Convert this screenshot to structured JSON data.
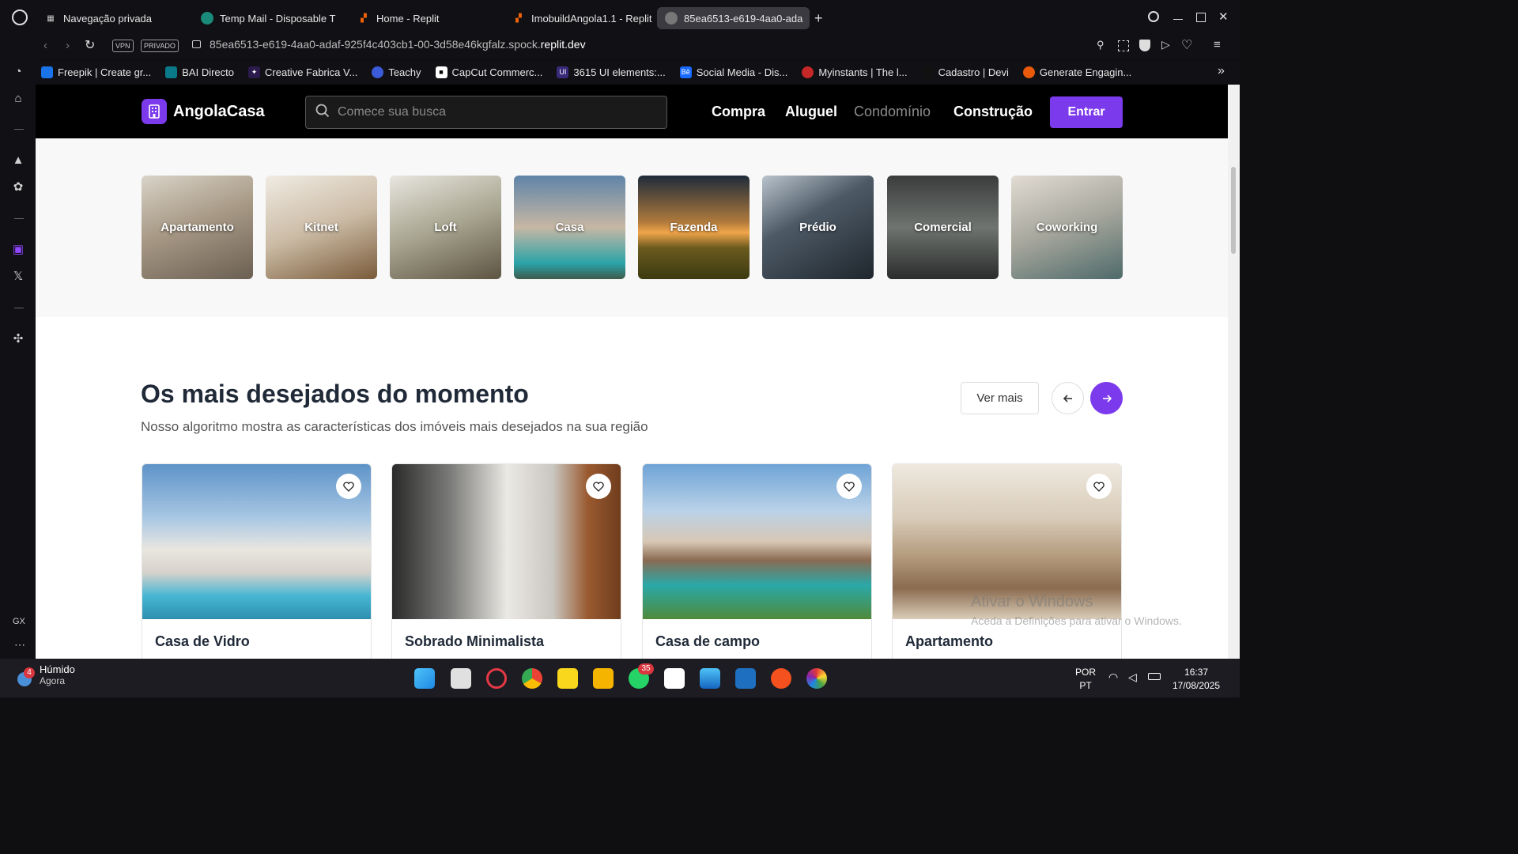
{
  "browser": {
    "tabs": [
      {
        "label": "Navegação privada"
      },
      {
        "label": "Temp Mail - Disposable T"
      },
      {
        "label": "Home - Replit"
      },
      {
        "label": "ImobuildAngola1.1 - Replit"
      },
      {
        "label": "85ea6513-e619-4aa0-ada"
      }
    ],
    "vpn_badge": "VPN",
    "private_badge": "PRIVADO",
    "url_prefix": "85ea6513-e619-4aa0-adaf-925f4c403cb1-00-3d58e46kgfalz.spock.",
    "url_domain": "replit.dev",
    "bookmarks": [
      {
        "label": "Freepik | Create gr...",
        "color": "#1a73e8"
      },
      {
        "label": "BAI Directo",
        "color": "#0a7a8a"
      },
      {
        "label": "Creative Fabrica V...",
        "color": "#2b1b4d"
      },
      {
        "label": "Teachy",
        "color": "#3b5bdb"
      },
      {
        "label": "CapCut Commerc...",
        "color": "#222222"
      },
      {
        "label": "3615 UI elements:...",
        "color": "#3a2a7a"
      },
      {
        "label": "Social Media - Dis...",
        "color": "#1769ff"
      },
      {
        "label": "Myinstants | The l...",
        "color": "#c62828"
      },
      {
        "label": "Cadastro | Devi",
        "color": "#111111"
      },
      {
        "label": "Generate Engagin...",
        "color": "#e8590c"
      }
    ]
  },
  "site": {
    "brand": "AngolaCasa",
    "search_placeholder": "Comece sua busca",
    "nav": {
      "compra": "Compra",
      "aluguel": "Aluguel",
      "condominio": "Condomínio",
      "construcao": "Construção"
    },
    "login_label": "Entrar",
    "categories": [
      {
        "label": "Apartamento"
      },
      {
        "label": "Kitnet"
      },
      {
        "label": "Loft"
      },
      {
        "label": "Casa"
      },
      {
        "label": "Fazenda"
      },
      {
        "label": "Prédio"
      },
      {
        "label": "Comercial"
      },
      {
        "label": "Coworking"
      }
    ],
    "section": {
      "title": "Os mais desejados do momento",
      "subtitle": "Nosso algoritmo mostra as características dos imóveis mais desejados na sua região",
      "see_more": "Ver mais"
    },
    "properties": [
      {
        "title": "Casa de Vidro"
      },
      {
        "title": "Sobrado Minimalista"
      },
      {
        "title": "Casa de campo"
      },
      {
        "title": "Apartamento"
      }
    ]
  },
  "watermark": {
    "line1": "Ativar o Windows",
    "line2": "Aceda a Definições para ativar o Windows."
  },
  "taskbar": {
    "weather_badge": "4",
    "weather_label": "Húmido",
    "weather_time": "Agora",
    "whatsapp_badge": "35",
    "lang1": "POR",
    "lang2": "PT",
    "time": "16:37",
    "date": "17/08/2025"
  },
  "accent_color": "#7c3aed"
}
